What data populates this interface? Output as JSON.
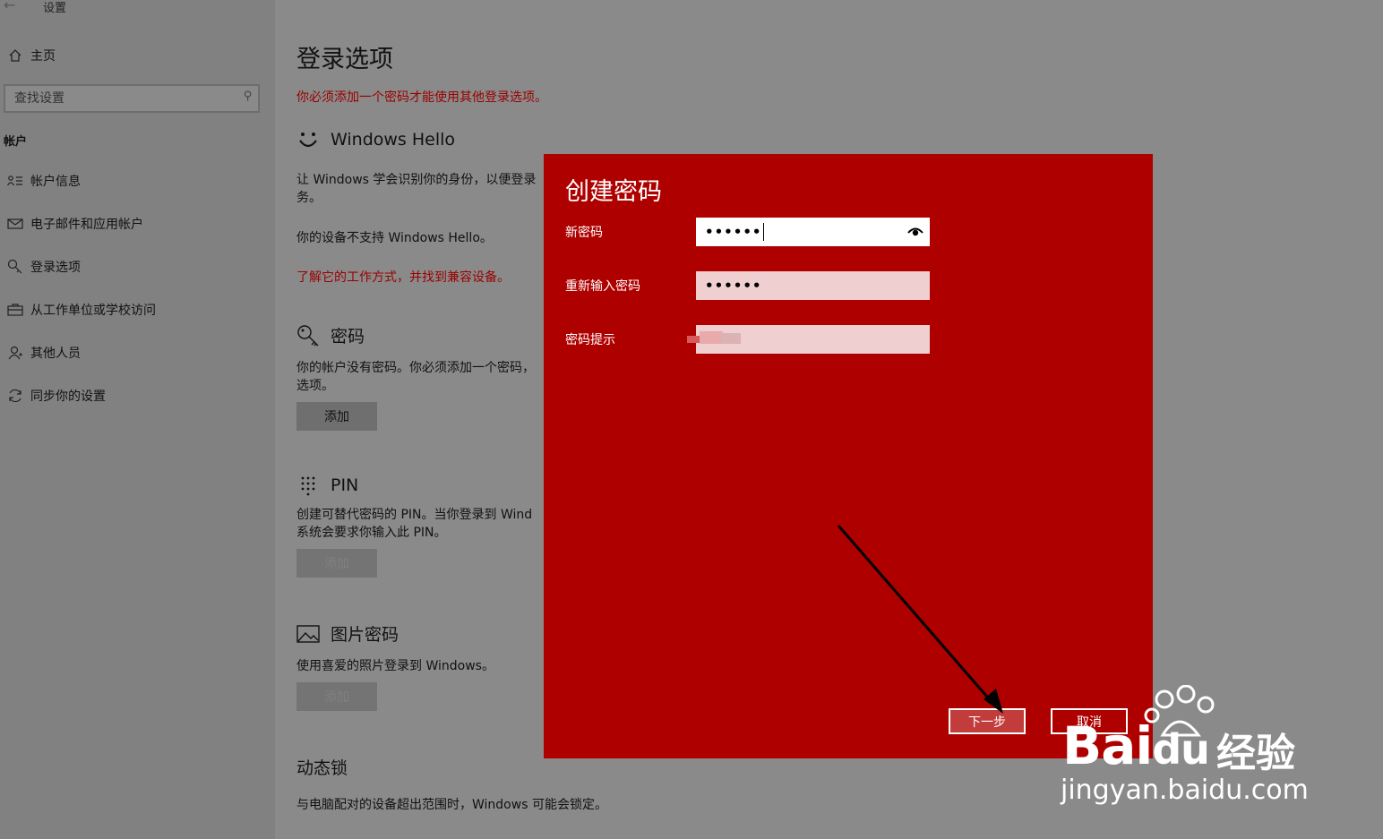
{
  "window": {
    "title": "设置",
    "back_icon": "back-arrow-icon"
  },
  "sidebar": {
    "home_label": "主页",
    "search": {
      "placeholder": "查找设置"
    },
    "section_label": "帐户",
    "items": [
      {
        "label": "帐户信息",
        "icon": "account-info-icon"
      },
      {
        "label": "电子邮件和应用帐户",
        "icon": "mail-icon"
      },
      {
        "label": "登录选项",
        "icon": "key-icon"
      },
      {
        "label": "从工作单位或学校访问",
        "icon": "briefcase-icon"
      },
      {
        "label": "其他人员",
        "icon": "person-icon"
      },
      {
        "label": "同步你的设置",
        "icon": "sync-icon"
      }
    ]
  },
  "main": {
    "title": "登录选项",
    "warning": "你必须添加一个密码才能使用其他登录选项。",
    "hello": {
      "heading": "Windows Hello",
      "desc_line1": "让 Windows 学会识别你的身份，以便登录",
      "desc_line2": "务。",
      "unsupported": "你的设备不支持 Windows Hello。",
      "learn_link": "了解它的工作方式，并找到兼容设备。"
    },
    "password": {
      "heading": "密码",
      "desc_line1": "你的帐户没有密码。你必须添加一个密码，",
      "desc_line2": "选项。",
      "add_label": "添加"
    },
    "pin": {
      "heading": "PIN",
      "desc_line1": "创建可替代密码的 PIN。当你登录到 Wind",
      "desc_line2": "系统会要求你输入此 PIN。",
      "add_label": "添加"
    },
    "picture": {
      "heading": "图片密码",
      "desc": "使用喜爱的照片登录到 Windows。",
      "add_label": "添加"
    },
    "dynamic_lock": {
      "heading": "动态锁",
      "desc": "与电脑配对的设备超出范围时，Windows 可能会锁定。"
    }
  },
  "dialog": {
    "title": "创建密码",
    "fields": {
      "new_password": {
        "label": "新密码",
        "value": "••••••"
      },
      "confirm_password": {
        "label": "重新输入密码",
        "value": "••••••"
      },
      "hint": {
        "label": "密码提示",
        "value": ""
      }
    },
    "next_label": "下一步",
    "cancel_label": "取消",
    "colors": {
      "background": "#af0000",
      "field": "#efcfcf",
      "text": "#ffffff"
    }
  },
  "watermark": {
    "brand": "Bai",
    "brand2": "du",
    "suffix": "经验",
    "url": "jingyan.baidu.com"
  }
}
